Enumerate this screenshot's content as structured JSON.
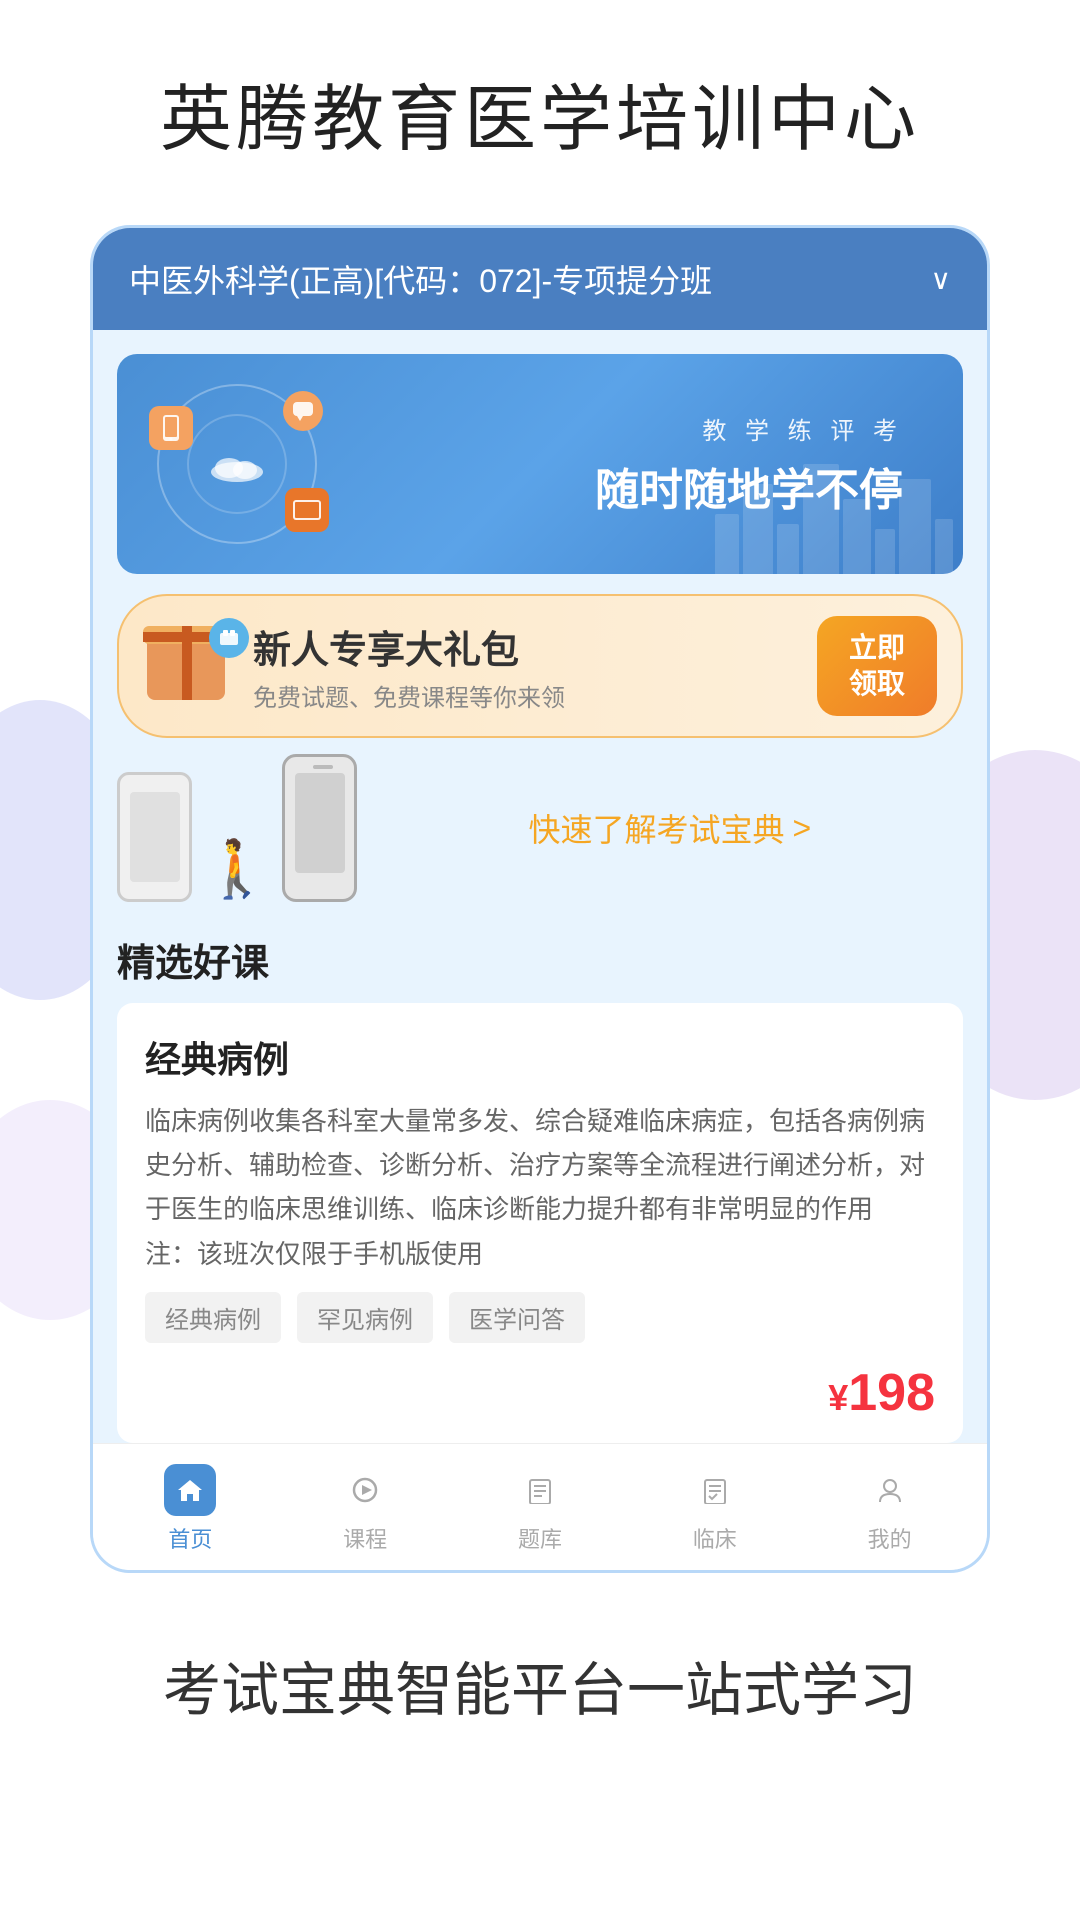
{
  "header": {
    "title": "英腾教育医学培训中心"
  },
  "course_selector": {
    "text": "中医外科学(正高)[代码：072]-专项提分班",
    "chevron": "∨"
  },
  "banner": {
    "subtitle": "教 学 练 评 考",
    "title": "随时随地学不停"
  },
  "gift_banner": {
    "title": "新人专享大礼包",
    "subtitle": "免费试题、免费课程等你来领",
    "btn_line1": "立即",
    "btn_line2": "领取"
  },
  "study_guide": {
    "link_text": "快速了解考试宝典",
    "arrow": ">"
  },
  "section": {
    "title": "精选好课"
  },
  "course_card": {
    "title": "经典病例",
    "description": "临床病例收集各科室大量常多发、综合疑难临床病症，包括各病例病史分析、辅助检查、诊断分析、治疗方案等全流程进行阐述分析，对于医生的临床思维训练、临床诊断能力提升都有非常明显的作用\n注：该班次仅限于手机版使用",
    "tags": [
      "经典病例",
      "罕见病例",
      "医学问答"
    ],
    "price_symbol": "¥",
    "price": "198"
  },
  "bottom_nav": {
    "items": [
      {
        "icon": "🏠",
        "label": "首页",
        "active": true
      },
      {
        "icon": "▷",
        "label": "课程",
        "active": false
      },
      {
        "icon": "☰",
        "label": "题库",
        "active": false
      },
      {
        "icon": "📋",
        "label": "临床",
        "active": false
      },
      {
        "icon": "◯",
        "label": "我的",
        "active": false
      }
    ]
  },
  "footer": {
    "title": "考试宝典智能平台一站式学习"
  }
}
